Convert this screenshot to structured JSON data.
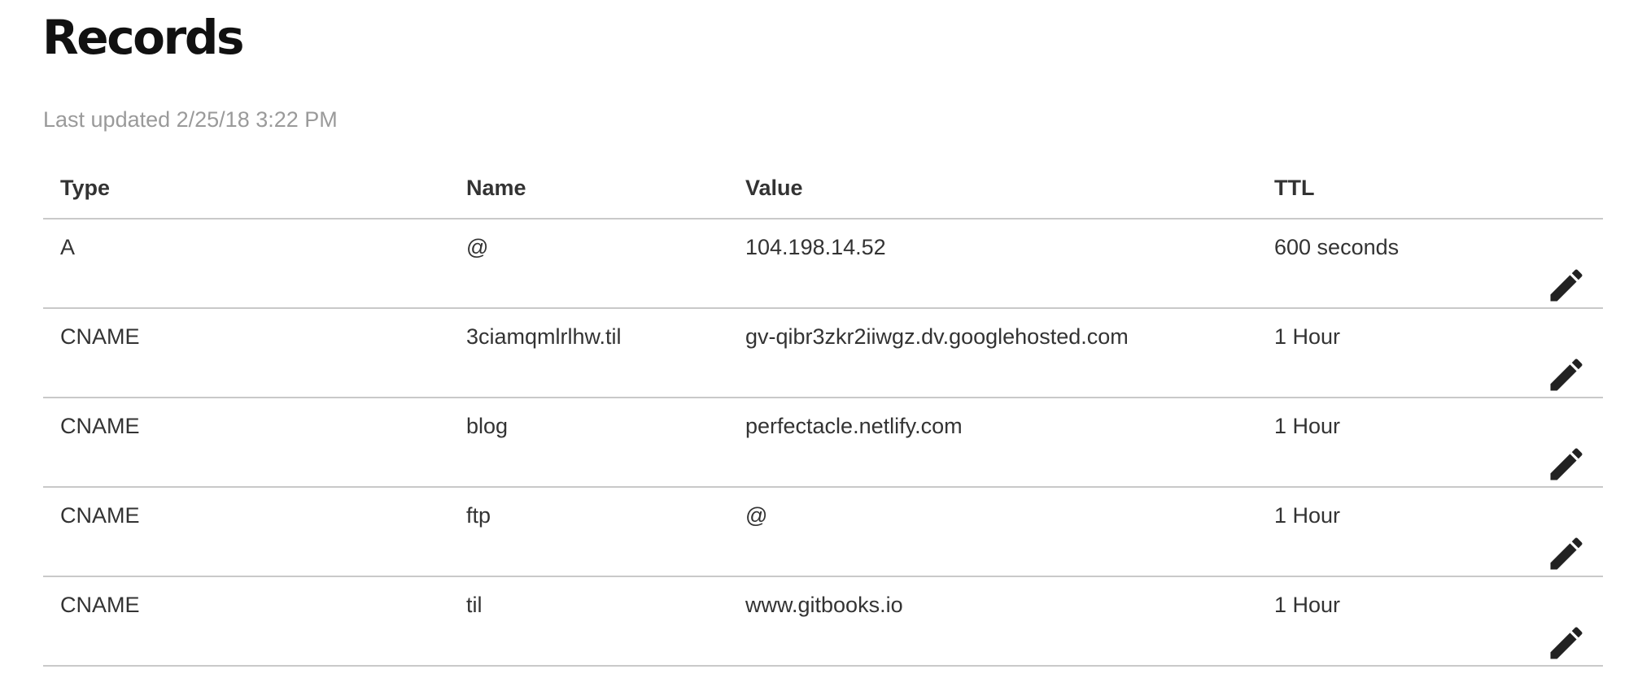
{
  "page": {
    "title": "Records",
    "last_updated": "Last updated 2/25/18 3:22 PM"
  },
  "table": {
    "columns": {
      "type": "Type",
      "name": "Name",
      "value": "Value",
      "ttl": "TTL"
    },
    "rows": [
      {
        "type": "A",
        "name": "@",
        "value": "104.198.14.52",
        "ttl": "600 seconds",
        "action_icon": "pencil-icon"
      },
      {
        "type": "CNAME",
        "name": "3ciamqmlrlhw.til",
        "value": "gv-qibr3zkr2iiwgz.dv.googlehosted.com",
        "ttl": "1 Hour",
        "action_icon": "pencil-icon"
      },
      {
        "type": "CNAME",
        "name": "blog",
        "value": "perfectacle.netlify.com",
        "ttl": "1 Hour",
        "action_icon": "pencil-icon"
      },
      {
        "type": "CNAME",
        "name": "ftp",
        "value": "@",
        "ttl": "1 Hour",
        "action_icon": "pencil-icon"
      },
      {
        "type": "CNAME",
        "name": "til",
        "value": "www.gitbooks.io",
        "ttl": "1 Hour",
        "action_icon": "pencil-icon"
      }
    ]
  },
  "colors": {
    "title": "#111111",
    "text": "#333333",
    "muted": "#9a9a9a",
    "divider": "#c9c9c9",
    "icon": "#222222"
  }
}
